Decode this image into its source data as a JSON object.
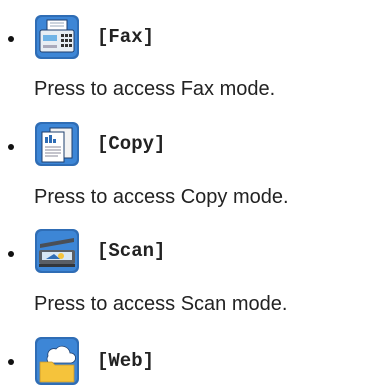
{
  "items": [
    {
      "icon": "fax-machine-icon",
      "label": "[Fax]",
      "description": "Press to access Fax mode."
    },
    {
      "icon": "copy-document-icon",
      "label": "[Copy]",
      "description": "Press to access Copy mode."
    },
    {
      "icon": "scanner-icon",
      "label": "[Scan]",
      "description": "Press to access Scan mode."
    },
    {
      "icon": "web-cloud-folder-icon",
      "label": "[Web]",
      "description": ""
    }
  ],
  "colors": {
    "text": "#222222",
    "icon_blue": "#2f6db5",
    "icon_dark": "#1e3f6e",
    "folder_yellow": "#f5c33b"
  }
}
